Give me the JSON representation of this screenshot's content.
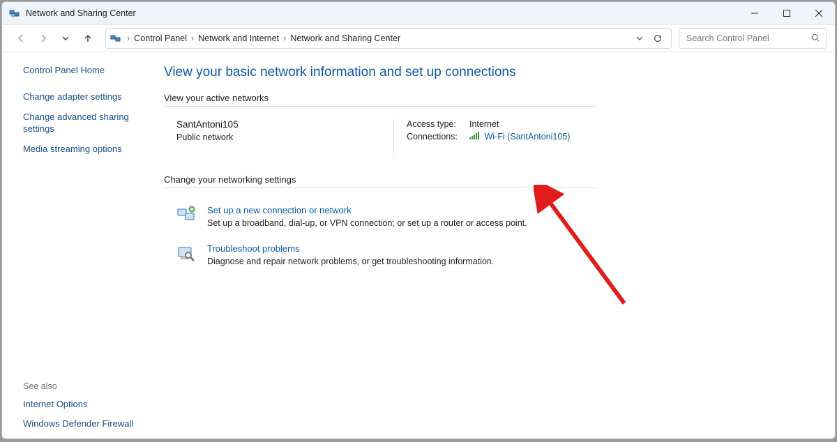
{
  "titlebar": {
    "title": "Network and Sharing Center"
  },
  "breadcrumbs": {
    "items": [
      "Control Panel",
      "Network and Internet",
      "Network and Sharing Center"
    ]
  },
  "search": {
    "placeholder": "Search Control Panel"
  },
  "sidebar": {
    "top": "Control Panel Home",
    "links": [
      "Change adapter settings",
      "Change advanced sharing settings",
      "Media streaming options"
    ],
    "see_also_label": "See also",
    "see_also": [
      "Internet Options",
      "Windows Defender Firewall"
    ]
  },
  "main": {
    "title": "View your basic network information and set up connections",
    "active_networks_label": "View your active networks",
    "network": {
      "name": "SantAntoni105",
      "type": "Public network",
      "access_type_label": "Access type:",
      "access_type_value": "Internet",
      "connections_label": "Connections:",
      "connection_link": "Wi-Fi (SantAntoni105)"
    },
    "change_settings_label": "Change your networking settings",
    "settings": [
      {
        "title": "Set up a new connection or network",
        "desc": "Set up a broadband, dial-up, or VPN connection; or set up a router or access point."
      },
      {
        "title": "Troubleshoot problems",
        "desc": "Diagnose and repair network problems, or get troubleshooting information."
      }
    ]
  }
}
